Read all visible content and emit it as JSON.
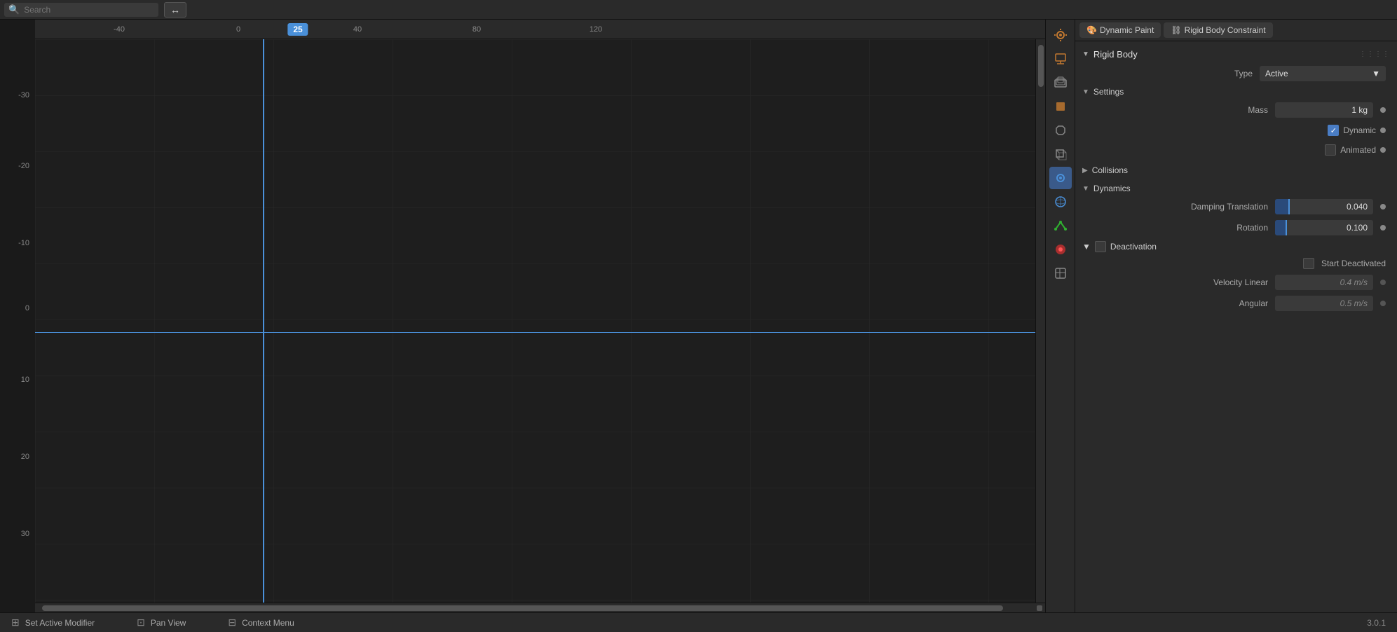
{
  "header": {
    "search_placeholder": "Search",
    "arrows_label": "↔"
  },
  "ruler": {
    "ticks": [
      "-40",
      "0",
      "40",
      "80",
      "120"
    ],
    "current_frame": "25"
  },
  "y_axis": {
    "labels": [
      "30",
      "20",
      "10",
      "0",
      "-10",
      "-20",
      "-30"
    ]
  },
  "status_bar": {
    "set_active_modifier": "Set Active Modifier",
    "pan_view": "Pan View",
    "context_menu": "Context Menu",
    "version": "3.0.1"
  },
  "properties": {
    "tabs": [
      {
        "id": "dynamic-paint",
        "label": "Dynamic Paint",
        "icon": "🎨"
      },
      {
        "id": "rigid-body-constraint",
        "label": "Rigid Body Constraint",
        "icon": "🔗"
      }
    ],
    "rigid_body": {
      "section_label": "Rigid Body",
      "type_label": "Type",
      "type_value": "Active",
      "settings": {
        "label": "Settings",
        "mass_label": "Mass",
        "mass_value": "1 kg",
        "dynamic_label": "Dynamic",
        "dynamic_checked": true,
        "animated_label": "Animated",
        "animated_checked": false
      },
      "collisions": {
        "label": "Collisions"
      },
      "dynamics": {
        "label": "Dynamics",
        "damping_translation_label": "Damping Translation",
        "damping_translation_value": "0.040",
        "rotation_label": "Rotation",
        "rotation_value": "0.100"
      },
      "deactivation": {
        "label": "Deactivation",
        "start_deactivated_label": "Start Deactivated",
        "start_deactivated_checked": false,
        "velocity_linear_label": "Velocity Linear",
        "velocity_linear_value": "0.4 m/s",
        "angular_label": "Angular",
        "angular_value": "0.5 m/s"
      }
    }
  },
  "side_icons": [
    {
      "id": "render",
      "symbol": "🎥",
      "active": false
    },
    {
      "id": "output",
      "symbol": "🖼",
      "active": false
    },
    {
      "id": "view-layer",
      "symbol": "🗂",
      "active": false
    },
    {
      "id": "scene",
      "symbol": "🟧",
      "active": false
    },
    {
      "id": "world",
      "symbol": "🔧",
      "active": false
    },
    {
      "id": "object",
      "symbol": "✦",
      "active": false
    },
    {
      "id": "particles",
      "symbol": "⬤",
      "active": true
    },
    {
      "id": "physics",
      "symbol": "⊙",
      "active": false
    },
    {
      "id": "constraints",
      "symbol": "🔺",
      "active": false
    },
    {
      "id": "data",
      "symbol": "🔴",
      "active": false
    },
    {
      "id": "material",
      "symbol": "⛶",
      "active": false
    }
  ]
}
